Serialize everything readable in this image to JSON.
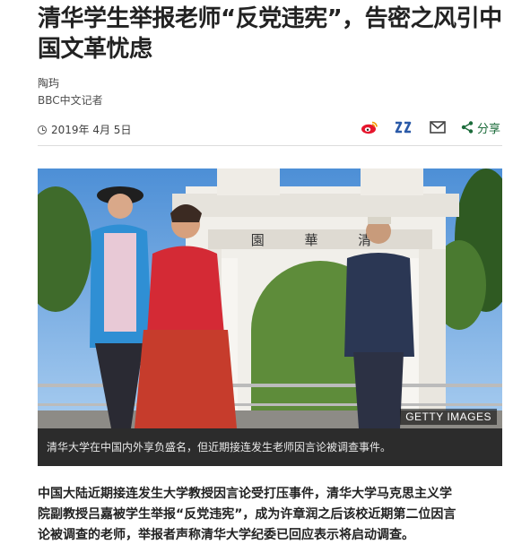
{
  "article": {
    "headline": "清华学生举报老师“反党违宪”，告密之风引中国文革忧虑",
    "author": "陶玙",
    "author_role": "BBC中文记者",
    "date": "2019年 4月 5日",
    "share_label": "分享",
    "image_credit": "GETTY IMAGES",
    "image_caption": "清华大学在中国内外享负盛名，但近期接连发生老师因言论被调查事件。",
    "body_paragraph": "中国大陆近期接连发生大学教授因言论受打压事件，清华大学马克思主义学院副教授吕嘉被学生举报“反党违宪”，成为许章润之后该校近期第二位因言论被调查的老师，举报者声称清华大学纪委已回应表示将启动调查。",
    "gate_sign": "園 華 清"
  },
  "share_icons": [
    "weibo-icon",
    "qzone-icon",
    "email-icon",
    "share-icon"
  ],
  "colors": {
    "weibo": "#e6162d",
    "qzone": "#2b5aa8",
    "share_accent": "#1b6b3a",
    "caption_bg": "#2c2c2c"
  }
}
